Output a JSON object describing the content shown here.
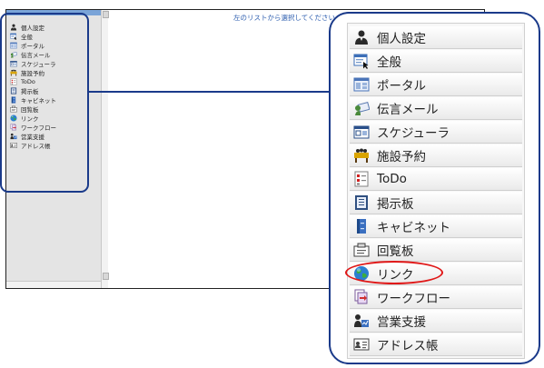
{
  "window": {
    "instruction": "左のリストから選択してください。"
  },
  "menu": {
    "items": [
      {
        "label": "個人設定",
        "icon": "person-icon"
      },
      {
        "label": "全般",
        "icon": "general-settings-icon"
      },
      {
        "label": "ポータル",
        "icon": "portal-icon"
      },
      {
        "label": "伝言メール",
        "icon": "message-mail-icon"
      },
      {
        "label": "スケジューラ",
        "icon": "scheduler-icon"
      },
      {
        "label": "施設予約",
        "icon": "facility-reservation-icon"
      },
      {
        "label": "ToDo",
        "icon": "todo-icon"
      },
      {
        "label": "掲示板",
        "icon": "bulletin-board-icon"
      },
      {
        "label": "キャビネット",
        "icon": "cabinet-icon"
      },
      {
        "label": "回覧板",
        "icon": "circular-icon"
      },
      {
        "label": "リンク",
        "icon": "globe-icon"
      },
      {
        "label": "ワークフロー",
        "icon": "workflow-icon"
      },
      {
        "label": "営業支援",
        "icon": "sales-support-icon"
      },
      {
        "label": "アドレス帳",
        "icon": "address-book-icon"
      }
    ],
    "highlighted": "リンク"
  },
  "colors": {
    "callout_border": "#1a3a8a",
    "highlight": "#e01818",
    "instruction_text": "#3060b0"
  }
}
